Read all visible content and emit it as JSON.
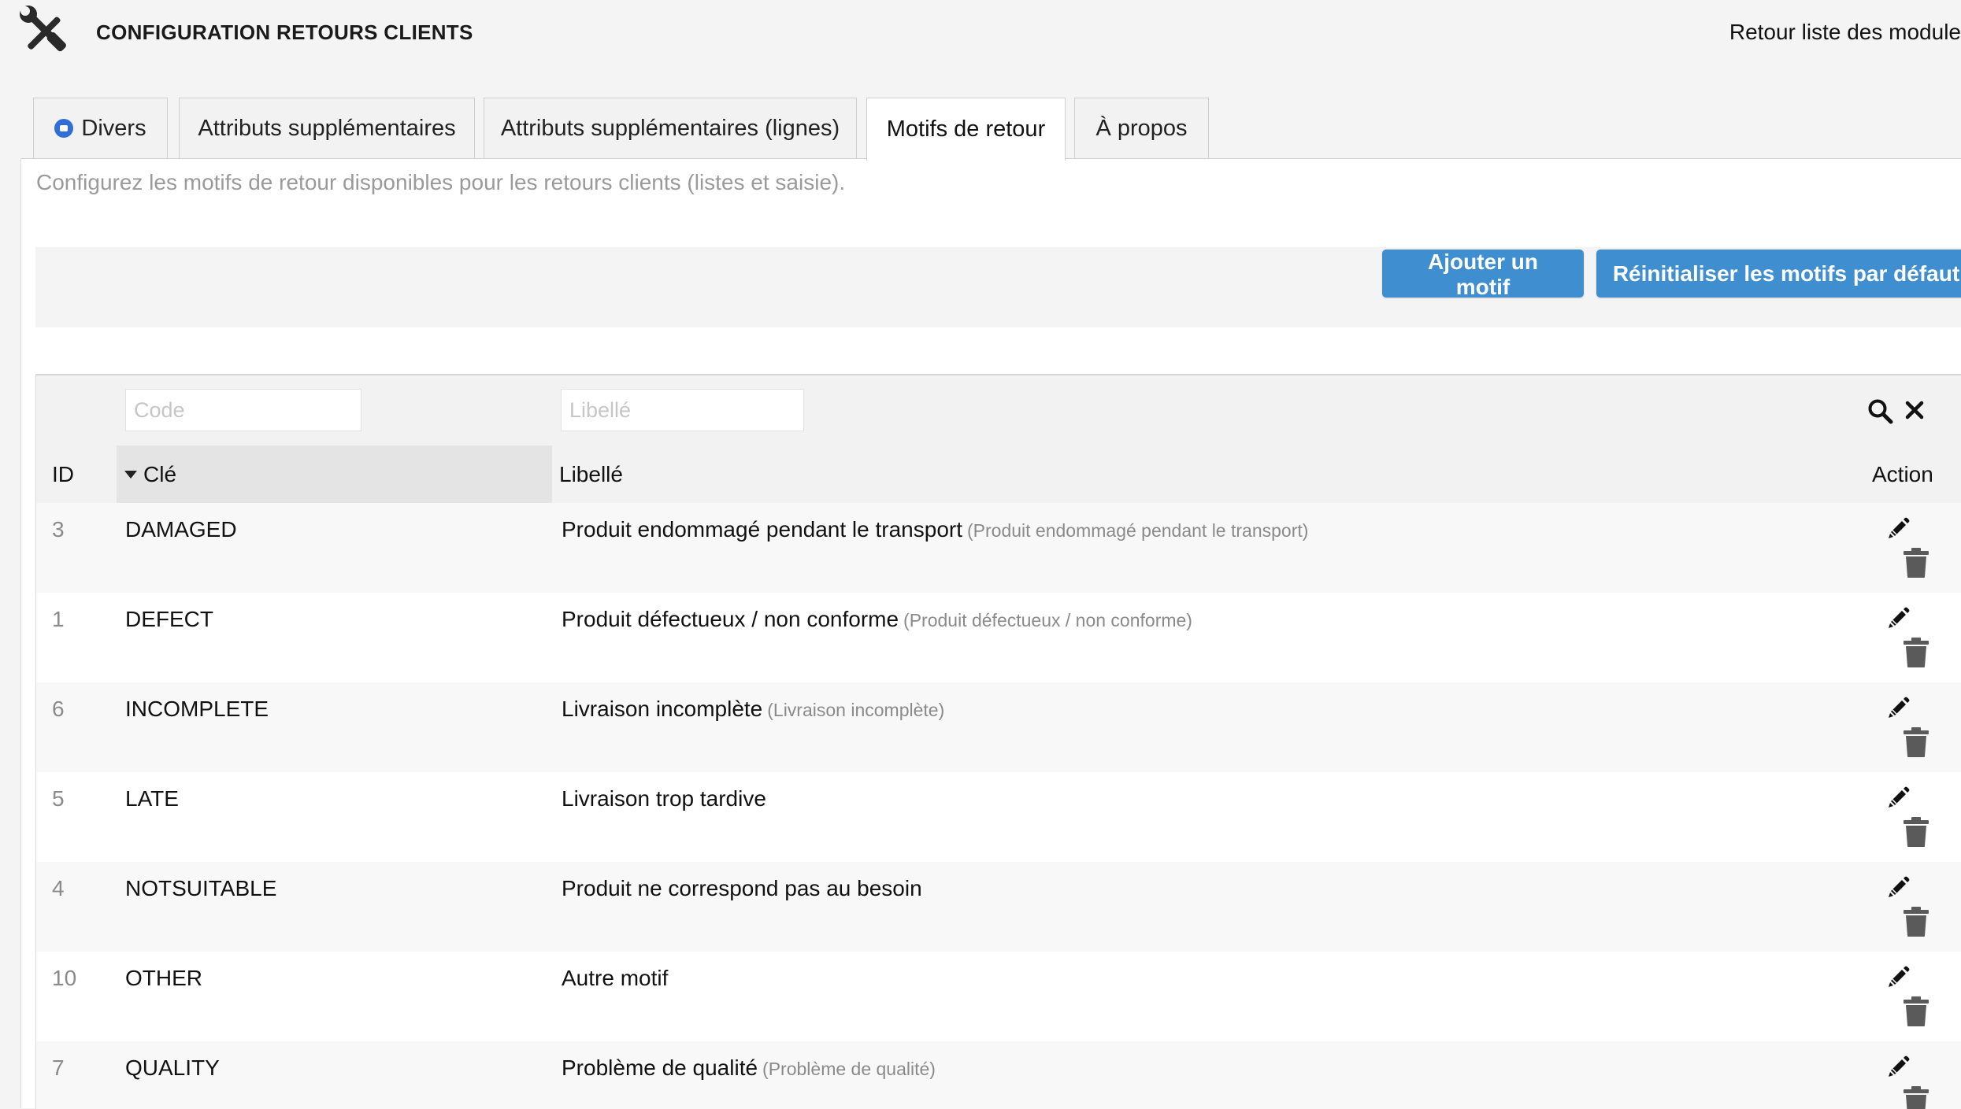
{
  "header": {
    "title": "CONFIGURATION RETOURS CLIENTS",
    "back_link": "Retour liste des module",
    "icon": "tools-icon"
  },
  "tabs": [
    {
      "label": "Divers",
      "active": false,
      "icon": "module-icon"
    },
    {
      "label": "Attributs supplémentaires",
      "active": false
    },
    {
      "label": "Attributs supplémentaires (lignes)",
      "active": false
    },
    {
      "label": "Motifs de retour",
      "active": true
    },
    {
      "label": "À propos",
      "active": false
    }
  ],
  "panel": {
    "description": "Configurez les motifs de retour disponibles pour les retours clients (listes et saisie).",
    "buttons": {
      "add": "Ajouter un motif",
      "reset": "Réinitialiser les motifs par défaut"
    }
  },
  "table": {
    "filters": {
      "code_placeholder": "Code",
      "label_placeholder": "Libellé"
    },
    "columns": {
      "id": "ID",
      "key": "Clé",
      "label": "Libellé",
      "action": "Action"
    },
    "rows": [
      {
        "id": "3",
        "key": "DAMAGED",
        "label": "Produit endommagé pendant le transport",
        "translation": "(Produit endommagé pendant le transport)"
      },
      {
        "id": "1",
        "key": "DEFECT",
        "label": "Produit défectueux / non conforme",
        "translation": "(Produit défectueux / non conforme)"
      },
      {
        "id": "6",
        "key": "INCOMPLETE",
        "label": "Livraison incomplète",
        "translation": "(Livraison incomplète)"
      },
      {
        "id": "5",
        "key": "LATE",
        "label": "Livraison trop tardive",
        "translation": ""
      },
      {
        "id": "4",
        "key": "NOTSUITABLE",
        "label": "Produit ne correspond pas au besoin",
        "translation": ""
      },
      {
        "id": "10",
        "key": "OTHER",
        "label": "Autre motif",
        "translation": ""
      },
      {
        "id": "7",
        "key": "QUALITY",
        "label": "Problème de qualité",
        "translation": "(Problème de qualité)"
      }
    ]
  },
  "colors": {
    "accent": "#3e8ed0",
    "tab_dot": "#2f6fd6"
  }
}
